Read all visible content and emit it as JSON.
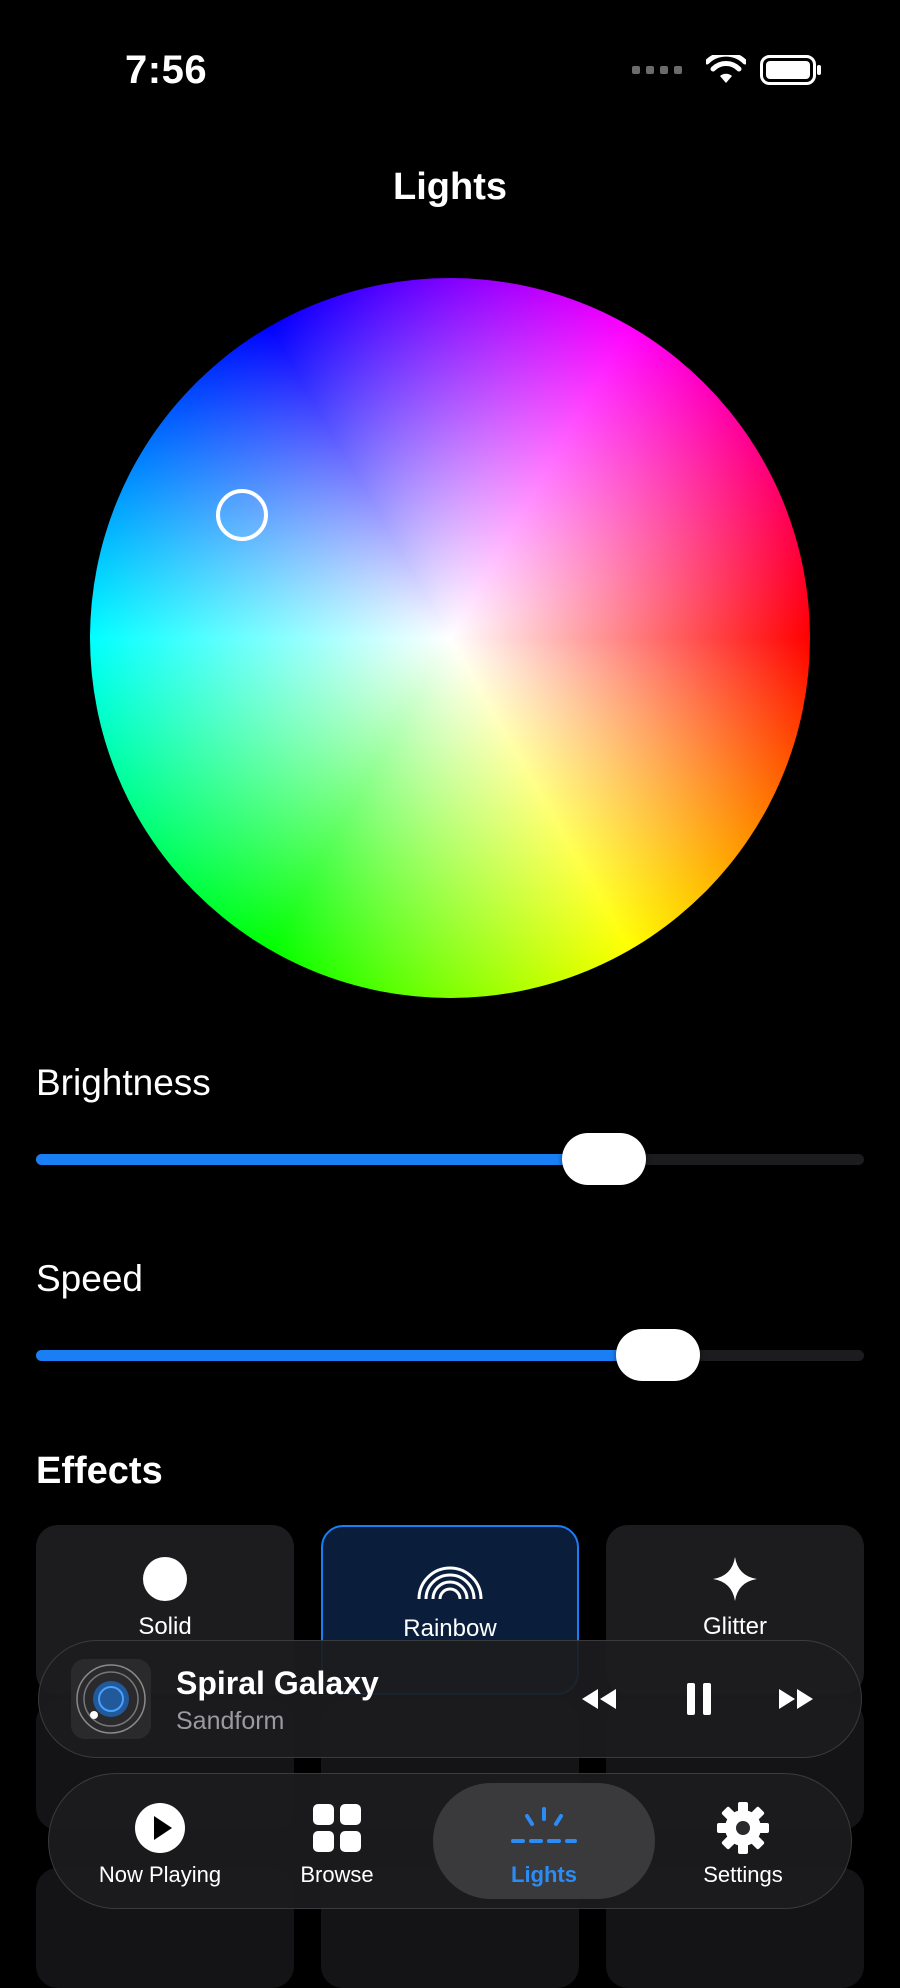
{
  "status_bar": {
    "time": "7:56"
  },
  "header": {
    "title": "Lights"
  },
  "color_wheel": {
    "selected_hue_deg": 232,
    "selected_saturation": 0.58
  },
  "brightness": {
    "label": "Brightness",
    "value": 0.68
  },
  "speed": {
    "label": "Speed",
    "value": 0.75
  },
  "effects": {
    "title": "Effects",
    "items": [
      {
        "label": "Solid",
        "icon": "circle-icon",
        "selected": false
      },
      {
        "label": "Rainbow",
        "icon": "rainbow-icon",
        "selected": true
      },
      {
        "label": "Glitter",
        "icon": "sparkle-icon",
        "selected": false
      }
    ]
  },
  "now_playing": {
    "title": "Spiral Galaxy",
    "artist": "Sandform"
  },
  "tab_bar": {
    "tabs": [
      {
        "label": "Now Playing",
        "icon": "play-circle-icon",
        "active": false
      },
      {
        "label": "Browse",
        "icon": "grid-icon",
        "active": false
      },
      {
        "label": "Lights",
        "icon": "lights-icon",
        "active": true
      },
      {
        "label": "Settings",
        "icon": "gear-icon",
        "active": false
      }
    ]
  },
  "colors": {
    "accent": "#1a7ff5",
    "background": "#000000",
    "tile": "#1c1c1e"
  }
}
